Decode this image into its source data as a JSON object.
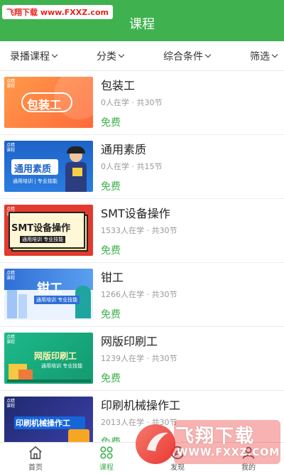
{
  "watermark_top": "飞翔下载 www.FXXZ.com",
  "watermark_bottom": {
    "text": "飞翔下载",
    "url": "WWW.FXXZ.COM"
  },
  "header": {
    "title": "课程"
  },
  "filters": [
    {
      "label": "录播课程"
    },
    {
      "label": "分类"
    },
    {
      "label": "综合条件"
    },
    {
      "label": "筛选"
    }
  ],
  "courses": [
    {
      "title": "包装工",
      "meta": "0人在学 · 共30节",
      "price": "免费",
      "thumb_text": "包装工",
      "thumb_sub": "",
      "badge": "点睛课程"
    },
    {
      "title": "通用素质",
      "meta": "0人在学 · 共15节",
      "price": "免费",
      "thumb_text": "通用素质",
      "thumb_sub": "通用培训 | 专业技能",
      "badge": "点睛课程"
    },
    {
      "title": "SMT设备操作",
      "meta": "1533人在学 · 共30节",
      "price": "免费",
      "thumb_text": "SMT设备操作",
      "thumb_sub": "通用培训  专业技能",
      "badge": "点睛课程"
    },
    {
      "title": "钳工",
      "meta": "1266人在学 · 共30节",
      "price": "免费",
      "thumb_text": "钳工",
      "thumb_sub": "通用培训  专业技能",
      "badge": "点睛课程"
    },
    {
      "title": "网版印刷工",
      "meta": "1239人在学 · 共30节",
      "price": "免费",
      "thumb_text": "网版印刷工",
      "thumb_sub": "通用培训 专业技能",
      "badge": "点睛课程"
    },
    {
      "title": "印刷机械操作工",
      "meta": "2013人在学 · 共30节",
      "price": "免费",
      "thumb_text": "印刷机械操作工",
      "thumb_sub": "",
      "badge": "点睛课程"
    }
  ],
  "tabs": [
    {
      "label": "首页",
      "icon": "home-icon"
    },
    {
      "label": "课程",
      "icon": "course-grid-icon"
    },
    {
      "label": "发现",
      "icon": "discover-icon"
    },
    {
      "label": "我的",
      "icon": "profile-icon"
    }
  ],
  "colors": {
    "accent": "#3fb24f",
    "watermark_red": "#e8231f"
  }
}
